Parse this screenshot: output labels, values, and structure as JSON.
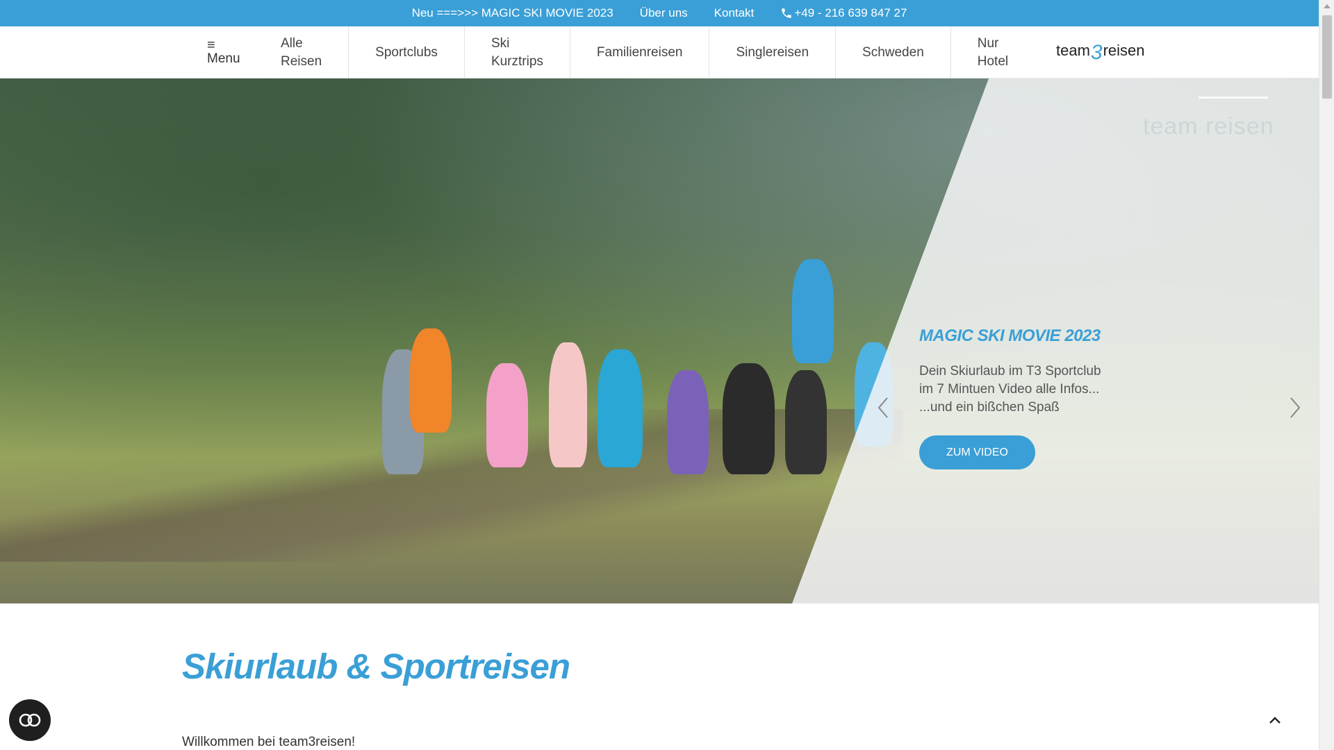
{
  "topbar": {
    "promo": "Neu ===>>> MAGIC SKI MOVIE 2023",
    "about": "Über uns",
    "contact": "Kontakt",
    "phone": "+49 - 216 639 847 27",
    "phone_icon": "phone-icon"
  },
  "nav": {
    "menu_label": "Menu",
    "menu_icon": "hamburger-icon",
    "items": [
      {
        "label": "Alle\nReisen"
      },
      {
        "label": "Sportclubs"
      },
      {
        "label": "Ski\nKurztrips"
      },
      {
        "label": "Familienreisen"
      },
      {
        "label": "Singlereisen"
      },
      {
        "label": "Schweden"
      },
      {
        "label": "Nur\nHotel"
      }
    ],
    "logo_left": "team",
    "logo_mid": "3",
    "logo_right": "reisen"
  },
  "hero": {
    "watermark": "team  reisen",
    "slide_title": "MAGIC SKI MOVIE 2023",
    "slide_lines": [
      "Dein Skiurlaub im T3 Sportclub",
      "im 7 Mintuen Video alle Infos...",
      "...und ein bißchen Spaß"
    ],
    "cta": "ZUM VIDEO",
    "prev_icon": "chevron-left-icon",
    "next_icon": "chevron-right-icon"
  },
  "content": {
    "headline": "Skiurlaub & Sportreisen",
    "welcome": "Willkommen bei team3reisen!"
  },
  "colors": {
    "accent": "#3a9fd6",
    "dark": "#1f1f1f"
  }
}
